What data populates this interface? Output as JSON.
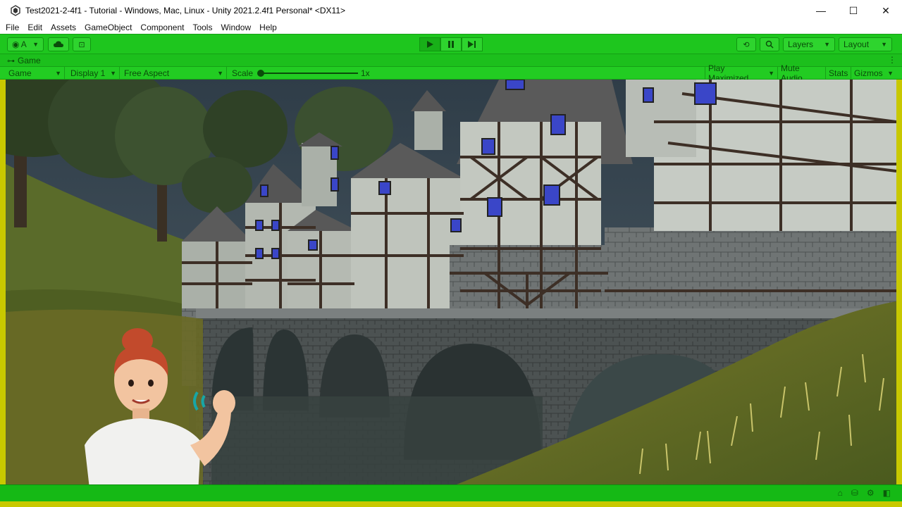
{
  "window": {
    "title": "Test2021-2-4f1 - Tutorial - Windows, Mac, Linux - Unity 2021.2.4f1 Personal* <DX11>",
    "controls": {
      "minimize": "—",
      "maximize": "☐",
      "close": "✕"
    }
  },
  "menu": {
    "items": [
      "File",
      "Edit",
      "Assets",
      "GameObject",
      "Component",
      "Tools",
      "Window",
      "Help"
    ]
  },
  "toolbar": {
    "account_label": "A",
    "layers_label": "Layers",
    "layout_label": "Layout",
    "play_icon": "play-icon",
    "pause_icon": "pause-icon",
    "step_icon": "step-icon"
  },
  "tabs": {
    "game_label": "Game",
    "menu_glyph": "⋮"
  },
  "gamebar": {
    "view_select": "Game",
    "display_select": "Display 1",
    "aspect_select": "Free Aspect",
    "scale_label": "Scale",
    "scale_value": "1x",
    "play_maximized": "Play Maximized",
    "mute_audio": "Mute Audio",
    "stats": "Stats",
    "gizmos": "Gizmos"
  },
  "colors": {
    "accent_green": "#1ec61e",
    "border_yellow": "#c8c800"
  }
}
